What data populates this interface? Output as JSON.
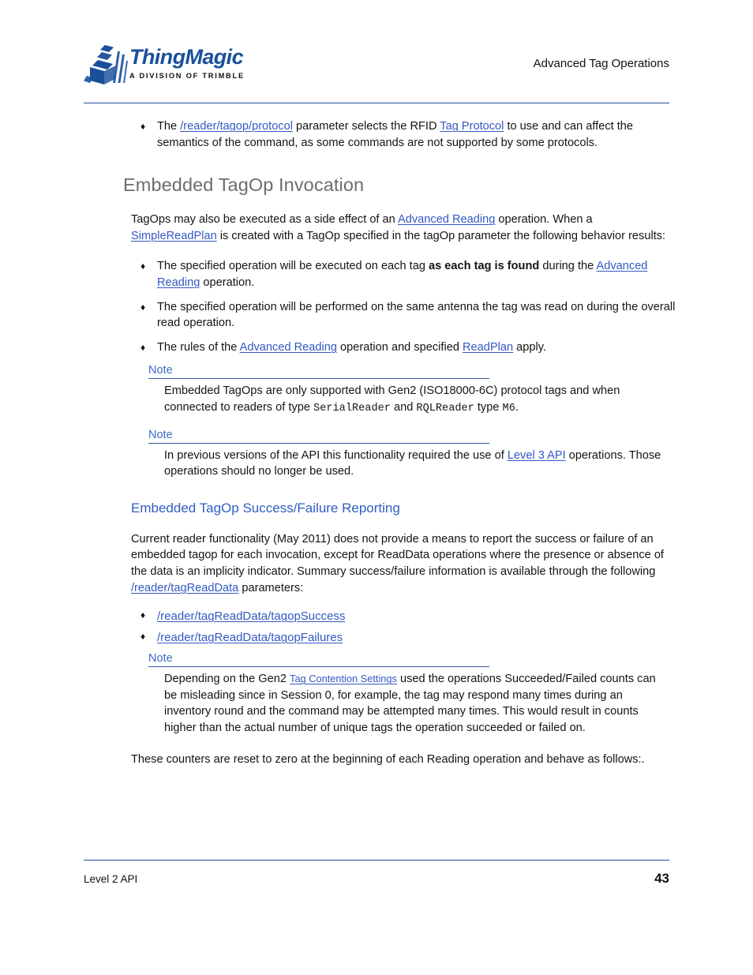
{
  "header": {
    "logo_wordmark": "ThingMagic",
    "logo_tagline": "A DIVISION OF TRIMBLE",
    "title": "Advanced Tag Operations",
    "logo_icon": "stacked-box-cube-icon"
  },
  "colors": {
    "link": "#3358c4",
    "heading_gray": "#6d6d6d",
    "subheading_blue": "#2f5fc0",
    "rule_blue": "#1f4e9c",
    "logo_blue": "#1a4f9c"
  },
  "intro_bullet": {
    "marker": "♦",
    "part1": "The ",
    "link1": "/reader/tagop/protocol",
    "part2": " parameter selects the RFID ",
    "link2": "Tag Protocol",
    "part3": " to use and can affect the semantics of the command, as some commands are not supported by some protocols."
  },
  "section": {
    "heading": "Embedded TagOp Invocation",
    "intro": {
      "part1": "TagOps may also be executed as a side effect of an ",
      "link1": "Advanced Reading",
      "part2": " operation. When a ",
      "link2": "SimpleReadPlan",
      "part3": " is created with a TagOp specified in the tagOp parameter the following behavior results:"
    },
    "bullets": [
      {
        "marker": "♦",
        "part1": "The specified operation will be executed on each tag ",
        "bold": "as each tag is found",
        "part2": " during the ",
        "link1": "Advanced Reading",
        "part3": " operation."
      },
      {
        "marker": "♦",
        "part1": "The specified operation will be performed on the same antenna the tag was read on during the overall read operation."
      },
      {
        "marker": "♦",
        "part1": "The rules of the ",
        "link1": "Advanced Reading",
        "part2": " operation and specified ",
        "link2": "ReadPlan",
        "part3": " apply."
      }
    ],
    "note1": {
      "label": "Note",
      "part1": "Embedded TagOps are only supported with Gen2 (ISO18000-6C) protocol tags and when connected to readers of type ",
      "mono1": "SerialReader",
      "part2": " and ",
      "mono2": "RQLReader",
      "part3": " type ",
      "mono3": "M6",
      "part4": "."
    },
    "note2": {
      "label": "Note",
      "part1": "In previous versions of the API this functionality required the use of ",
      "link1": "Level 3 API",
      "part2": " operations. Those operations should no longer be used."
    }
  },
  "subsection": {
    "heading": "Embedded TagOp Success/Failure Reporting",
    "paragraph": {
      "part1": "Current reader functionality (May 2011) does not provide a means to report the success or failure of an embedded tagop for each invocation, except for ReadData operations where the presence or absence of the data is an implicity indicator. Summary success/failure information is available through the following ",
      "link1": "/reader/tagReadData",
      "part2": " parameters:"
    },
    "param_bullets": [
      {
        "marker": "♦",
        "link": "/reader/tagReadData/tagopSuccess"
      },
      {
        "marker": "♦",
        "link": "/reader/tagReadData/tagopFailures"
      }
    ],
    "note3": {
      "label": "Note",
      "part1": "Depending on the Gen2 ",
      "link1": "Tag Contention Settings",
      "part2": " used the operations Succeeded/Failed counts can be misleading since in Session 0, for example, the tag may respond many times during an inventory round and the command may be attempted many times. This would result in counts higher than the actual number of unique tags the operation succeeded or failed on."
    },
    "closing": "These counters are reset to zero at the beginning of each Reading operation and behave as follows:."
  },
  "footer": {
    "left": "Level 2 API",
    "page_number": "43"
  }
}
